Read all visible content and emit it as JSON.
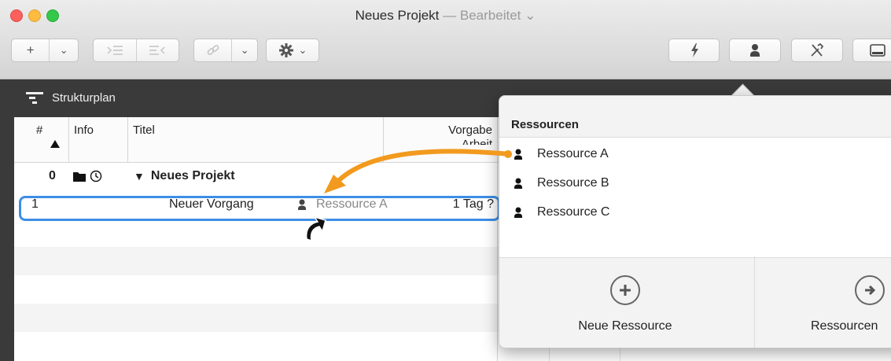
{
  "window": {
    "title": "Neues Projekt",
    "separator": "—",
    "status": "Bearbeitet",
    "status_chevron": "⌄"
  },
  "toolbar": {
    "add_label": "+",
    "chevron": "⌄"
  },
  "sidebar": {
    "section_label": "Strukturplan"
  },
  "table": {
    "headers": {
      "number": "#",
      "info": "Info",
      "title": "Titel",
      "default_work_line1": "Vorgabe",
      "default_work_line2": "Arbeit"
    },
    "rows": [
      {
        "number": "0",
        "title": "Neues Projekt",
        "disclosure": "▼"
      },
      {
        "number": "1",
        "title": "Neuer Vorgang",
        "resource": "Ressource A",
        "work": "1 Tag ?"
      }
    ]
  },
  "popover": {
    "title": "Ressourcen",
    "items": [
      "Ressource A",
      "Ressource B",
      "Ressource C"
    ],
    "new_resource_label": "Neue Ressource",
    "resources_label": "Ressourcen"
  },
  "colors": {
    "selection": "#3d8ee6",
    "drag_arrow": "#f29a1e"
  }
}
